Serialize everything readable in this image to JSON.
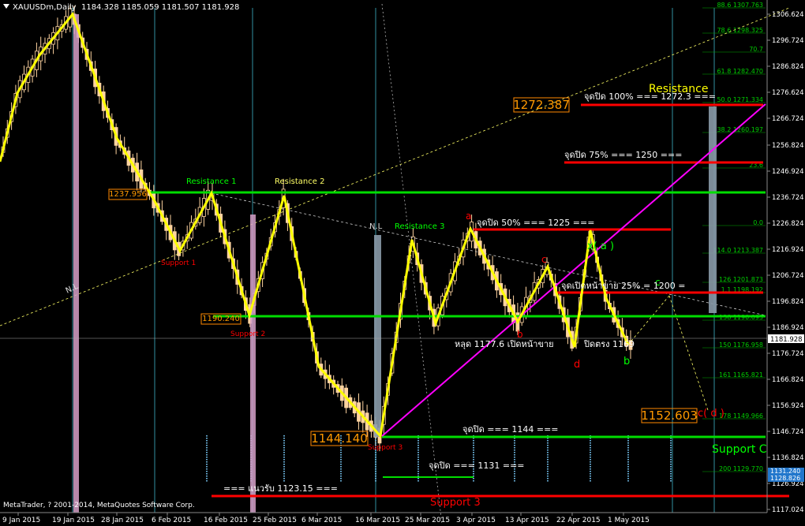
{
  "header": {
    "symbol": "XAUUSDm,Daily",
    "ohlc": "1184.328 1185.059 1181.507 1181.928"
  },
  "footer": {
    "copyright": "MetaTrader, ? 2001-2014, MetaQuotes Software Corp."
  },
  "price_axis": {
    "labels": [
      "1306.624",
      "1296.724",
      "1286.824",
      "1276.624",
      "1266.724",
      "1256.824",
      "1246.924",
      "1236.724",
      "1226.824",
      "1216.924",
      "1206.724",
      "1196.824",
      "1186.924",
      "1176.724",
      "1166.824",
      "1156.924",
      "1146.724",
      "1136.824",
      "1126.924",
      "1117.024"
    ],
    "current_price": "1181.928",
    "marks": [
      "1131.240",
      "1128.826"
    ]
  },
  "time_axis": {
    "labels": [
      "9 Jan 2015",
      "19 Jan 2015",
      "28 Jan 2015",
      "6 Feb 2015",
      "16 Feb 2015",
      "25 Feb 2015",
      "6 Mar 2015",
      "16 Mar 2015",
      "25 Mar 2015",
      "3 Apr 2015",
      "13 Apr 2015",
      "22 Apr 2015",
      "1 May 2015"
    ]
  },
  "fib_levels": [
    {
      "label": "88.6 1307.763"
    },
    {
      "label": "78.6 1298.325"
    },
    {
      "label": "70.7"
    },
    {
      "label": "61.8 1282.470"
    },
    {
      "label": "50.0 1271.334"
    },
    {
      "label": "38.2 1260.197"
    },
    {
      "label": "23.6"
    },
    {
      "label": "0.0"
    },
    {
      "label": "114.0 1213.387"
    },
    {
      "label": "126 1201.873"
    },
    {
      "label": "1.1 1198.192"
    },
    {
      "label": "138 1190.093"
    },
    {
      "label": "150 1176.958"
    },
    {
      "label": "161 1165.821"
    },
    {
      "label": "178 1149.966"
    },
    {
      "label": "200 1129.770"
    }
  ],
  "hlines": {
    "res1": {
      "label": "Resistance 1",
      "color": "#00dd00"
    },
    "res2": {
      "label": "Resistance 2",
      "color": "#00dd00"
    },
    "res3": {
      "label": "Resistance 3",
      "color": "#00dd00"
    },
    "resistance": {
      "label": "Resistance",
      "color": "#ffff00"
    },
    "support3": {
      "label": "Support 3",
      "color": "#ff0000"
    },
    "supportC": {
      "label": "Support C",
      "color": "#00dd00"
    }
  },
  "red_lines": [
    {
      "label": "จุดปิด 100%  ===  1272.3 ==="
    },
    {
      "label": "จุดปิด 75%  ===  1250 ==="
    },
    {
      "label": "จุดปิด 50%  ===  1225 ==="
    },
    {
      "label": "จุดเปิดหน้าขาย 25% = 1200 ="
    }
  ],
  "green_texts": {
    "close_1144": "จุดปิด  ===  1144  ===",
    "close_1131": "จุดปิด  ===  1131 ===",
    "break": "หลุด 1177.6 เปิดหน้าขาย",
    "close_1169": "ปิดตรง 1169",
    "support_1123": "=== แนวรับ 1123.15 ==="
  },
  "boxes": {
    "b1237": "1237.956",
    "b1190": "1190.240",
    "b1144": "1144.140",
    "b1272": "1272.387",
    "b1152": "1152.603"
  },
  "labels": {
    "support1": "Support 1",
    "support2": "Support 2",
    "support3b": "Support 3",
    "wave_a": "a",
    "wave_b": "b",
    "wave_c": "c",
    "wave_d": "d",
    "wave_xa": "x( a )",
    "wave_b2": "b",
    "wave_c2": "c",
    "cd": "c( d )",
    "nl1": "N.L",
    "nl2": "N.L"
  },
  "colors": {
    "background": "#000000",
    "bull": "#ffd4a0",
    "bear": "#ffd4a0",
    "zigzag": "#ffff00",
    "trend": "#ff00ff",
    "support_green": "#00ff00",
    "target_red": "#ff0000",
    "box": "#ff8800"
  }
}
